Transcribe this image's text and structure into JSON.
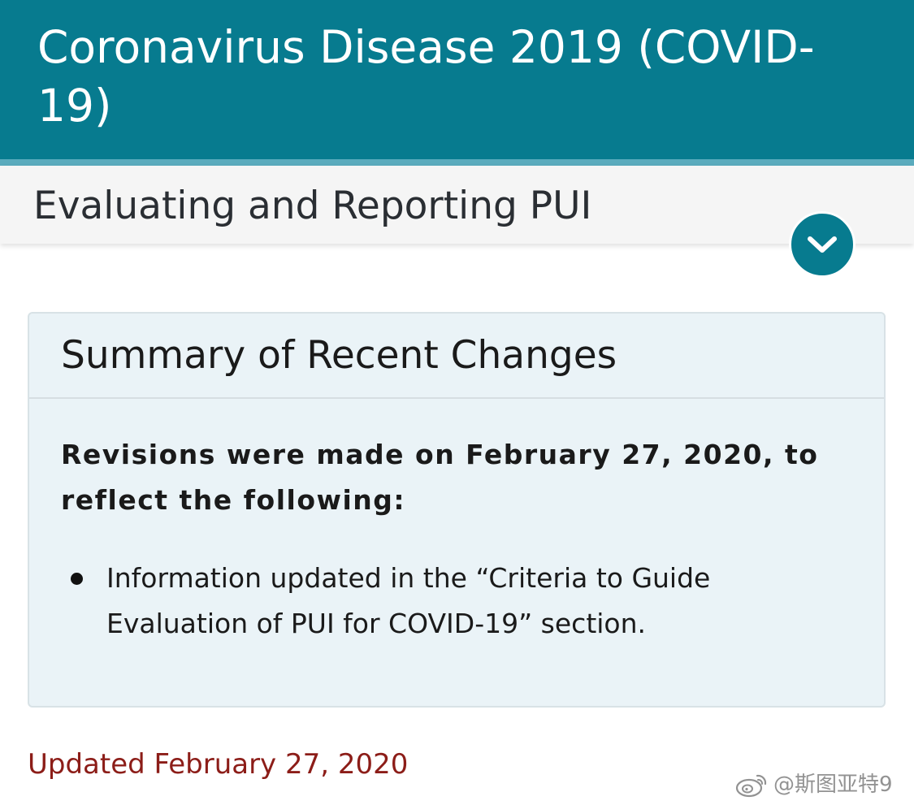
{
  "header": {
    "title": "Coronavirus Disease 2019 (COVID-19)"
  },
  "subnav": {
    "title": "Evaluating and Reporting PUI",
    "toggle_icon": "chevron-down-icon"
  },
  "summary": {
    "title": "Summary of Recent Changes",
    "intro": "Revisions were made on February 27, 2020, to reflect the following:",
    "items": [
      "Information updated in the “Criteria to Guide Evaluation of PUI for COVID-19” section."
    ]
  },
  "updated": "Updated February 27, 2020",
  "watermark": {
    "text": "@斯图亚特9",
    "logo_icon": "weibo-logo-icon"
  },
  "colors": {
    "header_bg": "#077b8f",
    "stripe": "#5aabbd",
    "card_bg": "#eaf3f7",
    "updated_text": "#8c1d18"
  }
}
